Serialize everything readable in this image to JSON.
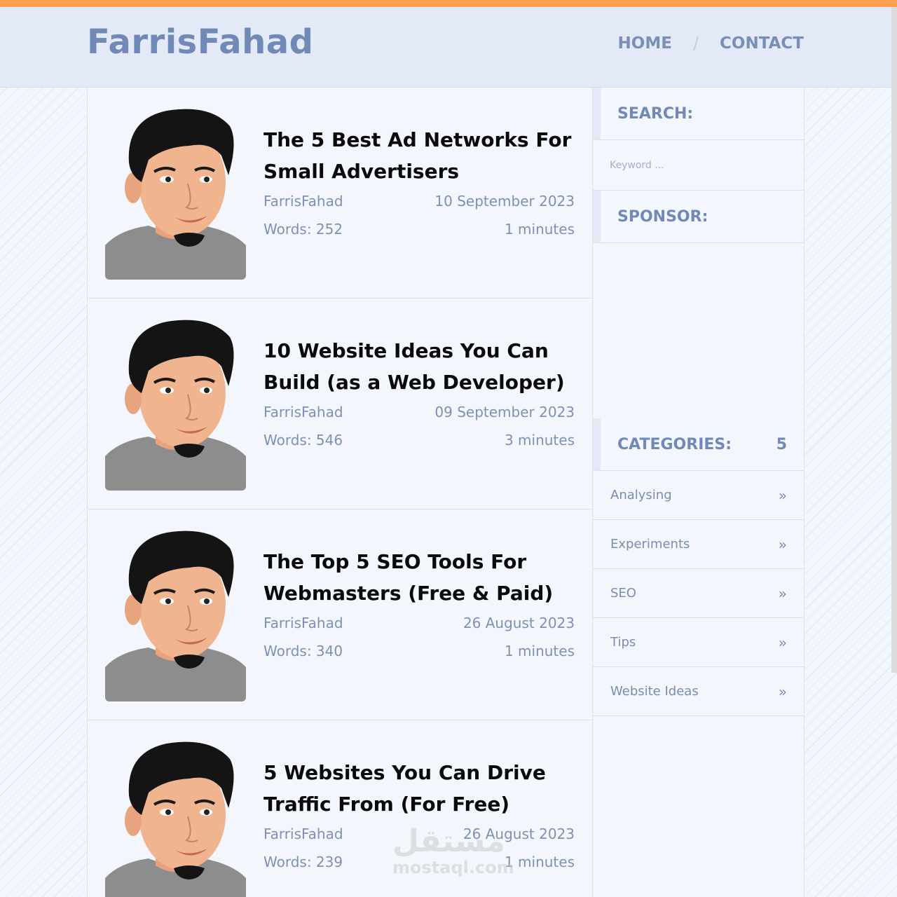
{
  "site": {
    "logo": "FarrisFahad",
    "nav": [
      {
        "label": "HOME"
      },
      {
        "label": "CONTACT"
      }
    ],
    "nav_separator": "/"
  },
  "posts": [
    {
      "title": "The 5 Best Ad Networks For Small Advertisers",
      "author": "FarrisFahad",
      "date": "10 September 2023",
      "words": "Words: 252",
      "read_time": "1 minutes"
    },
    {
      "title": "10 Website Ideas You Can Build (as a Web Developer)",
      "author": "FarrisFahad",
      "date": "09 September 2023",
      "words": "Words: 546",
      "read_time": "3 minutes"
    },
    {
      "title": "The Top 5 SEO Tools For Webmasters (Free & Paid)",
      "author": "FarrisFahad",
      "date": "26 August 2023",
      "words": "Words: 340",
      "read_time": "1 minutes"
    },
    {
      "title": "5 Websites You Can Drive Traffic From (For Free)",
      "author": "FarrisFahad",
      "date": "26 August 2023",
      "words": "Words: 239",
      "read_time": "1 minutes"
    }
  ],
  "sidebar": {
    "search": {
      "heading": "SEARCH:",
      "placeholder": "Keyword ..."
    },
    "sponsor": {
      "heading": "SPONSOR:"
    },
    "categories": {
      "heading": "CATEGORIES:",
      "count": "5",
      "chevron": "»",
      "items": [
        {
          "label": "Analysing"
        },
        {
          "label": "Experiments"
        },
        {
          "label": "SEO"
        },
        {
          "label": "Tips"
        },
        {
          "label": "Website Ideas"
        }
      ]
    }
  },
  "watermark": {
    "arabic": "مستقل",
    "latin": "mostaql.com"
  },
  "colors": {
    "accent_bar": "#ff9f52",
    "header_bg": "#e3e9f7",
    "logo": "#7189b6",
    "muted_text": "#7e90b4",
    "title_text": "#0a0a0a"
  }
}
